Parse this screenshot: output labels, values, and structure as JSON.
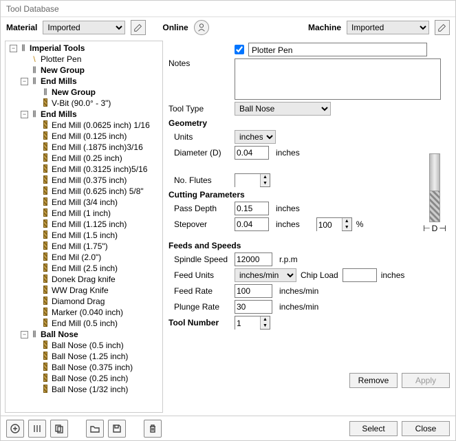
{
  "window": {
    "title": "Tool Database"
  },
  "topbar": {
    "material_label": "Material",
    "material_value": "Imported",
    "online_label": "Online",
    "machine_label": "Machine",
    "machine_value": "Imported"
  },
  "tree": [
    {
      "indent": 0,
      "exp": "-",
      "icon": "group",
      "label": "Imperial Tools",
      "bold": true
    },
    {
      "indent": 1,
      "exp": "",
      "icon": "plotter",
      "label": "Plotter Pen"
    },
    {
      "indent": 1,
      "exp": "",
      "icon": "group",
      "label": "New Group",
      "bold": true
    },
    {
      "indent": 1,
      "exp": "-",
      "icon": "group",
      "label": "End Mills",
      "bold": true
    },
    {
      "indent": 2,
      "exp": "",
      "icon": "group",
      "label": "New Group",
      "bold": true
    },
    {
      "indent": 2,
      "exp": "",
      "icon": "vbit",
      "label": "V-Bit (90.0° - 3\")"
    },
    {
      "indent": 1,
      "exp": "-",
      "icon": "group",
      "label": "End Mills",
      "bold": true
    },
    {
      "indent": 2,
      "exp": "",
      "icon": "endmill",
      "label": "End Mill (0.0625 inch) 1/16"
    },
    {
      "indent": 2,
      "exp": "",
      "icon": "endmill",
      "label": "End Mill (0.125 inch)"
    },
    {
      "indent": 2,
      "exp": "",
      "icon": "endmill",
      "label": "End Mill (.1875 inch)3/16"
    },
    {
      "indent": 2,
      "exp": "",
      "icon": "endmill",
      "label": "End Mill (0.25 inch)"
    },
    {
      "indent": 2,
      "exp": "",
      "icon": "endmill",
      "label": "End Mill (0.3125 inch)5/16"
    },
    {
      "indent": 2,
      "exp": "",
      "icon": "endmill",
      "label": "End Mill (0.375 inch)"
    },
    {
      "indent": 2,
      "exp": "",
      "icon": "endmill",
      "label": "End Mill (0.625 inch) 5/8\""
    },
    {
      "indent": 2,
      "exp": "",
      "icon": "endmill",
      "label": "End Mill (3/4 inch)"
    },
    {
      "indent": 2,
      "exp": "",
      "icon": "endmill",
      "label": "End Mill (1 inch)"
    },
    {
      "indent": 2,
      "exp": "",
      "icon": "endmill",
      "label": "End Mill (1.125 inch)"
    },
    {
      "indent": 2,
      "exp": "",
      "icon": "endmill",
      "label": "End Mill (1.5 inch)"
    },
    {
      "indent": 2,
      "exp": "",
      "icon": "endmill",
      "label": "End Mill (1.75\")"
    },
    {
      "indent": 2,
      "exp": "",
      "icon": "endmill",
      "label": "End Mil (2.0\")"
    },
    {
      "indent": 2,
      "exp": "",
      "icon": "endmill",
      "label": "End Mill (2.5 inch)"
    },
    {
      "indent": 2,
      "exp": "",
      "icon": "endmill",
      "label": "Donek Drag knife"
    },
    {
      "indent": 2,
      "exp": "",
      "icon": "endmill",
      "label": "WW Drag Knife"
    },
    {
      "indent": 2,
      "exp": "",
      "icon": "endmill",
      "label": "Diamond Drag"
    },
    {
      "indent": 2,
      "exp": "",
      "icon": "endmill",
      "label": "Marker (0.040 inch)"
    },
    {
      "indent": 2,
      "exp": "",
      "icon": "endmill",
      "label": "End Mill (0.5 inch)"
    },
    {
      "indent": 1,
      "exp": "-",
      "icon": "group",
      "label": "Ball Nose",
      "bold": true
    },
    {
      "indent": 2,
      "exp": "",
      "icon": "endmill",
      "label": "Ball Nose (0.5 inch)"
    },
    {
      "indent": 2,
      "exp": "",
      "icon": "endmill",
      "label": "Ball Nose (1.25  inch)"
    },
    {
      "indent": 2,
      "exp": "",
      "icon": "endmill",
      "label": "Ball Nose (0.375 inch)"
    },
    {
      "indent": 2,
      "exp": "",
      "icon": "endmill",
      "label": "Ball Nose (0.25 inch)"
    },
    {
      "indent": 2,
      "exp": "",
      "icon": "endmill",
      "label": "Ball Nose (1/32  inch)"
    }
  ],
  "details": {
    "name_checked": true,
    "name": "Plotter Pen",
    "notes_label": "Notes",
    "notes": "",
    "tooltype_label": "Tool Type",
    "tooltype_value": "Ball Nose",
    "geometry_head": "Geometry",
    "units_label": "Units",
    "units_value": "inches",
    "diameter_label": "Diameter (D)",
    "diameter_value": "0.04",
    "diameter_unit": "inches",
    "noflutes_label": "No. Flutes",
    "noflutes_value": "",
    "cutting_head": "Cutting Parameters",
    "passdepth_label": "Pass Depth",
    "passdepth_value": "0.15",
    "passdepth_unit": "inches",
    "stepover_label": "Stepover",
    "stepover_value": "0.04",
    "stepover_unit": "inches",
    "stepover_pct": "100",
    "pct_sign": "%",
    "feeds_head": "Feeds and Speeds",
    "spindle_label": "Spindle Speed",
    "spindle_value": "12000",
    "spindle_unit": "r.p.m",
    "feedunits_label": "Feed Units",
    "feedunits_value": "inches/min",
    "chipload_label": "Chip Load",
    "chipload_value": "",
    "chipload_unit": "inches",
    "feedrate_label": "Feed Rate",
    "feedrate_value": "100",
    "feedrate_unit": "inches/min",
    "plunge_label": "Plunge Rate",
    "plunge_value": "30",
    "plunge_unit": "inches/min",
    "toolnum_label": "Tool Number",
    "toolnum_value": "1",
    "dim_label": "D"
  },
  "buttons": {
    "remove": "Remove",
    "apply": "Apply",
    "select": "Select",
    "close": "Close"
  }
}
